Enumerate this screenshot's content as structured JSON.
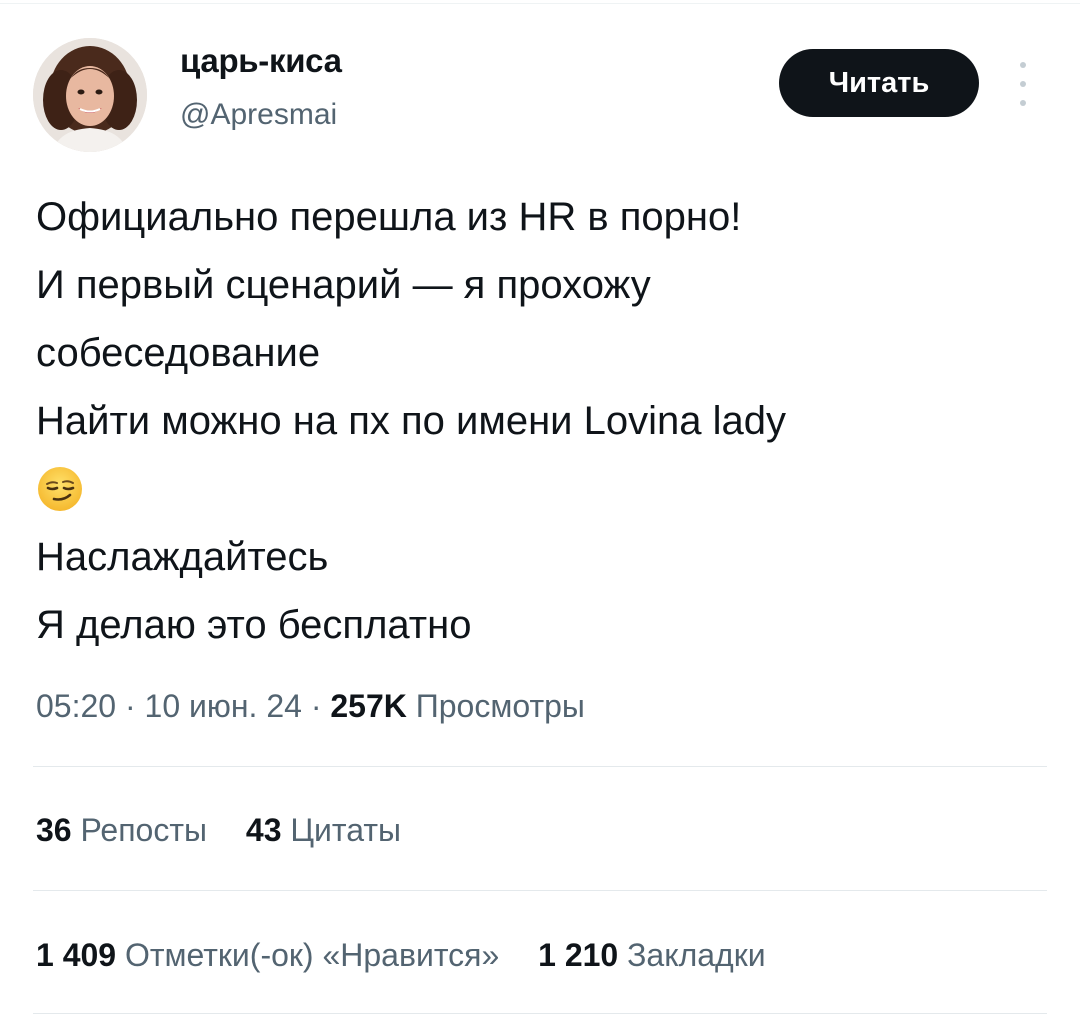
{
  "author": {
    "display_name": "царь-киса",
    "handle": "@Apresmai"
  },
  "follow_button": {
    "label": "Читать"
  },
  "tweet": {
    "lines": [
      "Официально перешла из HR в порно!",
      "И первый сценарий — я прохожу",
      "собеседование",
      "Найти можно на пх по имени Lovina lady"
    ],
    "emoji": "smirking-face",
    "lines_after_emoji": [
      "Наслаждайтесь",
      "Я делаю это бесплатно"
    ]
  },
  "meta": {
    "time": "05:20",
    "separator": "·",
    "date": "10 июн. 24",
    "views_count": "257K",
    "views_label": "Просмотры"
  },
  "stats": {
    "reposts": {
      "count": "36",
      "label": "Репосты"
    },
    "quotes": {
      "count": "43",
      "label": "Цитаты"
    },
    "likes": {
      "count": "1 409",
      "label": "Отметки(-ок) «Нравится»"
    },
    "bookmarks": {
      "count": "1 210",
      "label": "Закладки"
    }
  },
  "colors": {
    "text_primary": "#0f1419",
    "text_secondary": "#536471",
    "divider": "#e4e9ec",
    "button_bg": "#0f1419",
    "button_text": "#ffffff"
  }
}
